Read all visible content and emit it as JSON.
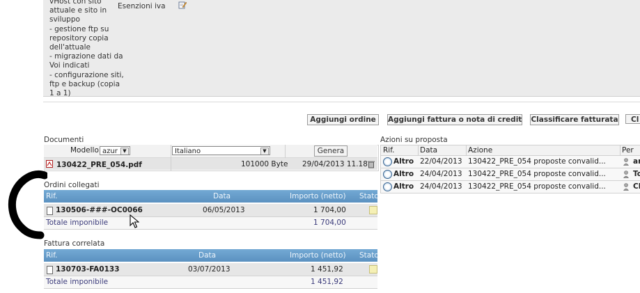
{
  "description": {
    "lines": [
      "vHost con sito",
      "attuale e sito in",
      "sviluppo",
      "- gestione ftp su",
      "repository copia",
      "dell'attuale",
      "- migrazione dati da",
      "Voi indicati",
      "- configurazione siti,",
      "ftp e backup (copia",
      "1 a 1)"
    ],
    "iva_label": "Esenzioni iva"
  },
  "toolbar": {
    "add_order": "Aggiungi ordine",
    "add_invoice": "Aggiungi fattura o nota di credito",
    "classify": "Classificare fatturata",
    "cut": "Cl"
  },
  "documents": {
    "title": "Documenti",
    "model_label": "Modello",
    "model_value": "azur",
    "language_value": "Italiano",
    "generate_label": "Genera",
    "file_name": "130422_PRE_054.pdf",
    "file_size": "101000 Byte",
    "file_date": "29/04/2013 11.18"
  },
  "orders": {
    "title": "Ordini collegati",
    "headers": {
      "ref": "Rif.",
      "date": "Data",
      "amount": "Importo (netto)",
      "status": "Stato"
    },
    "row": {
      "ref": "130506-###-OC0066",
      "date": "06/05/2013",
      "amount": "1 704,00"
    },
    "total_label": "Totale imponibile",
    "total_value": "1 704,00"
  },
  "invoices": {
    "title": "Fattura correlata",
    "headers": {
      "ref": "Rif.",
      "date": "Data",
      "amount": "Importo (netto)",
      "status": "Stato"
    },
    "row": {
      "ref": "130703-FA0133",
      "date": "03/07/2013",
      "amount": "1 451,92"
    },
    "total_label": "Totale imponibile",
    "total_value": "1 451,92"
  },
  "actions": {
    "title": "Azioni su proposta",
    "headers": {
      "ref": "Rif.",
      "date": "Data",
      "action": "Azione",
      "by": "Per"
    },
    "rows": [
      {
        "type": "Altro",
        "date": "22/04/2013",
        "action": "130422_PRE_054 proposte convalid...",
        "by": "an"
      },
      {
        "type": "Altro",
        "date": "24/04/2013",
        "action": "130422_PRE_054 proposte convalid...",
        "by": "To"
      },
      {
        "type": "Altro",
        "date": "24/04/2013",
        "action": "130422_PRE_054 proposte convalid...",
        "by": "Cl"
      }
    ]
  },
  "colors": {
    "header_blue": "#5b91c0",
    "panel_gray": "#ebebeb",
    "status_yellow": "#f5f0b5"
  },
  "icons": [
    "edit-icon",
    "pdf-icon",
    "document-icon",
    "clock-icon",
    "person-icon",
    "mouse-cursor-icon",
    "trash-icon"
  ]
}
